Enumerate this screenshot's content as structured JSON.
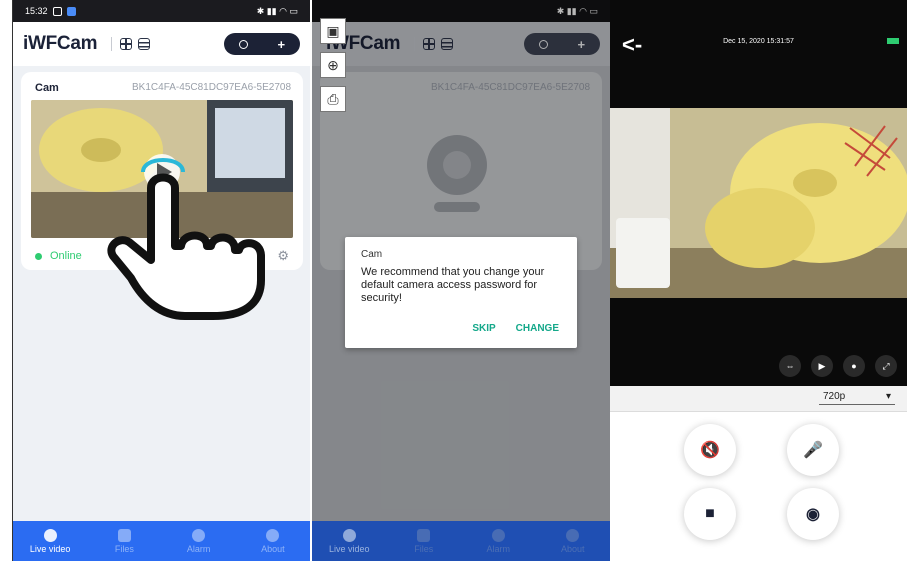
{
  "screen1": {
    "status": {
      "time": "15:32"
    },
    "app_name": "iWFCam",
    "camera": {
      "name": "Cam",
      "id": "BK1C4FA-45C81DC97EA6-5E2708",
      "status": "Online"
    },
    "tabs": [
      {
        "label": "Live video",
        "icon": "play-icon"
      },
      {
        "label": "Files",
        "icon": "folder-icon"
      },
      {
        "label": "Alarm",
        "icon": "alarm-icon"
      },
      {
        "label": "About",
        "icon": "puzzle-icon"
      }
    ]
  },
  "screen2": {
    "app_name": "iWFCam",
    "camera_id": "BK1C4FA-45C81DC97EA6-5E2708",
    "dialog": {
      "title": "Cam",
      "message": "We recommend that you change your default camera access password for security!",
      "skip": "SKIP",
      "change": "CHANGE"
    },
    "tabs": [
      "Live video",
      "Files",
      "Alarm",
      "About"
    ]
  },
  "screen3": {
    "timestamp": "Dec 15, 2020 15:31:57",
    "resolution": "720p",
    "colors": {
      "record_indicator": "#2ecc71",
      "accent": "#2b6cf2"
    }
  }
}
